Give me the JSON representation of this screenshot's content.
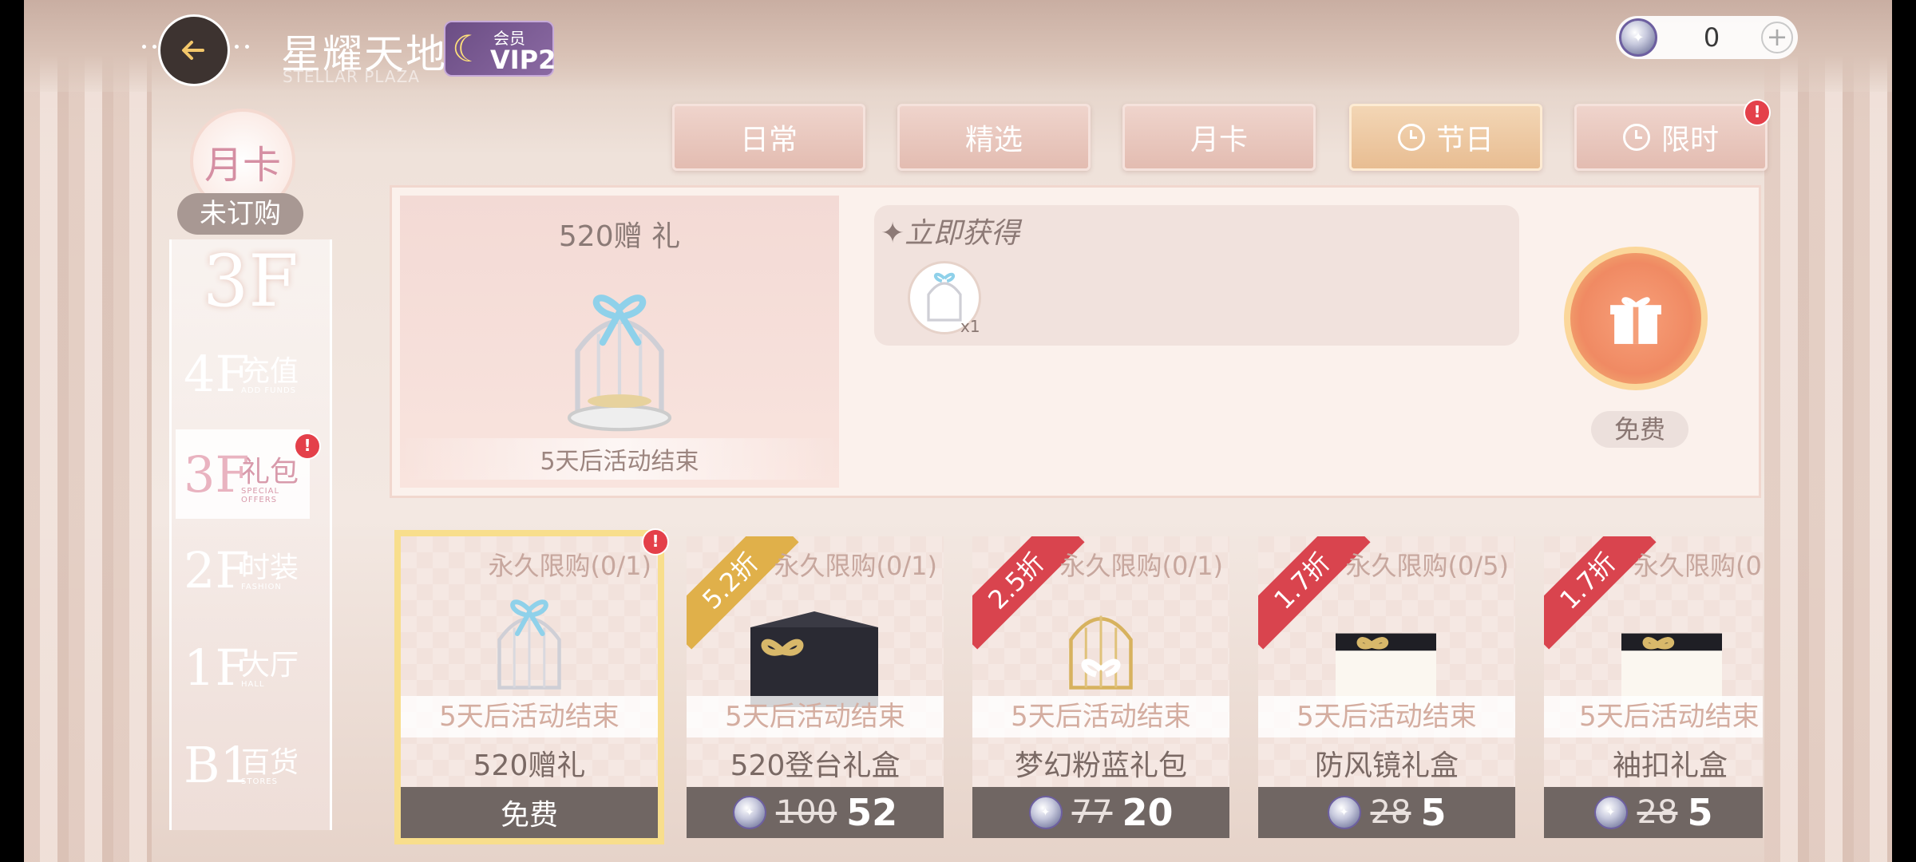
{
  "header": {
    "title": "星耀天地",
    "subtitle": "STELLAR PLAZA",
    "vip_tag": "会员",
    "vip_level": "VIP2",
    "currency_value": "0",
    "currency_plus": "+"
  },
  "left_nav": {
    "badge_label": "月卡",
    "subscription_status": "未订购",
    "current_floor": "3F",
    "floors": [
      {
        "num": "4F",
        "label": "充值",
        "en": "ADD FUNDS"
      },
      {
        "num": "3F",
        "label": "礼包",
        "en": "SPECIAL OFFERS",
        "alert": "!"
      },
      {
        "num": "2F",
        "label": "时装",
        "en": "FASHION"
      },
      {
        "num": "1F",
        "label": "大厅",
        "en": "HALL"
      },
      {
        "num": "B1",
        "label": "百货",
        "en": "STORES"
      }
    ]
  },
  "tabs": [
    {
      "label": "日常"
    },
    {
      "label": "精选"
    },
    {
      "label": "月卡"
    },
    {
      "label": "节日",
      "active": true
    },
    {
      "label": "限时",
      "alert": "!"
    }
  ],
  "banner": {
    "title": "520赠 礼",
    "ends": "5天后活动结束",
    "reward_heading": "✦立即获得",
    "reward_qty": "x1",
    "claim_label": "免费"
  },
  "products": [
    {
      "limit": "永久限购(0/1)",
      "ends": "5天后活动结束",
      "name": "520赠礼",
      "price": "免费",
      "alert": "!"
    },
    {
      "discount": "5.2折",
      "limit": "永久限购(0/1)",
      "ends": "5天后活动结束",
      "name": "520登台礼盒",
      "orig": "100",
      "now": "52"
    },
    {
      "discount": "2.5折",
      "limit": "永久限购(0/1)",
      "ends": "5天后活动结束",
      "name": "梦幻粉蓝礼包",
      "orig": "77",
      "now": "20"
    },
    {
      "discount": "1.7折",
      "limit": "永久限购(0/5)",
      "ends": "5天后活动结束",
      "name": "防风镜礼盒",
      "orig": "28",
      "now": "5"
    },
    {
      "discount": "1.7折",
      "limit": "永久限购(0",
      "ends": "5天后活动结束",
      "name": "袖扣礼盒",
      "orig": "28",
      "now": "5"
    }
  ],
  "colors": {
    "ribbon_gold": "#e0b04a",
    "ribbon_red": "#d9444e",
    "accent_pink": "#e9b3c0"
  }
}
